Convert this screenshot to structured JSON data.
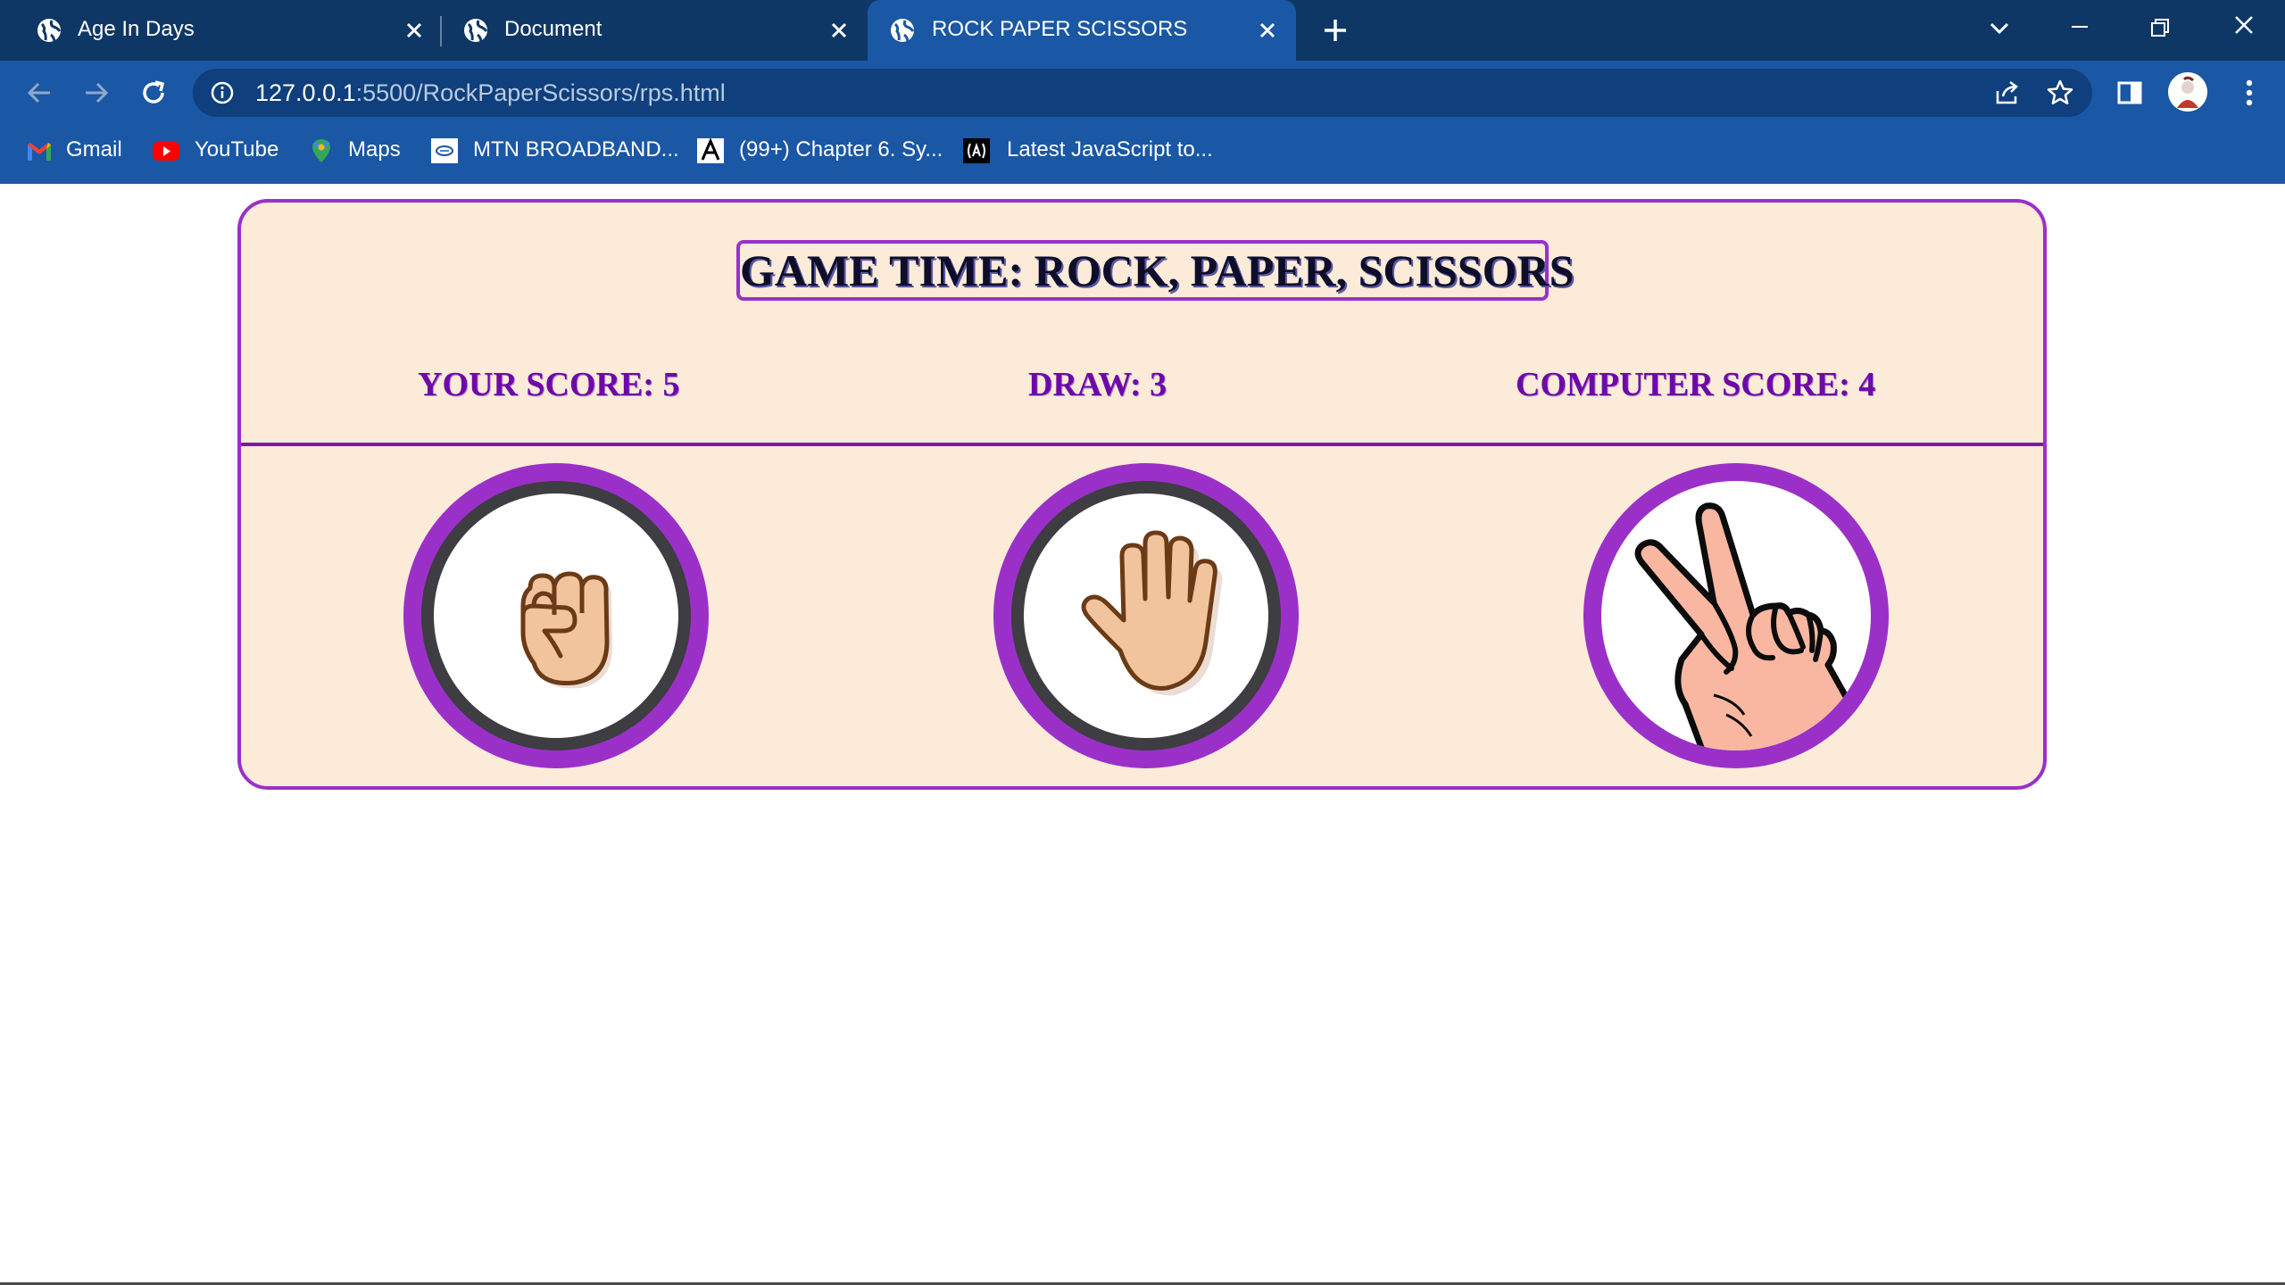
{
  "browser": {
    "tabs": [
      {
        "title": "Age In Days",
        "active": false
      },
      {
        "title": "Document",
        "active": false
      },
      {
        "title": "ROCK PAPER SCISSORS",
        "active": true
      }
    ],
    "url_host": "127.0.0.1",
    "url_path": ":5500/RockPaperScissors/rps.html",
    "bookmarks": [
      {
        "label": "Gmail",
        "icon": "gmail-icon"
      },
      {
        "label": "YouTube",
        "icon": "youtube-icon"
      },
      {
        "label": "Maps",
        "icon": "maps-icon"
      },
      {
        "label": "MTN BROADBAND...",
        "icon": "mtn-icon"
      },
      {
        "label": "(99+) Chapter 6. Sy...",
        "icon": "academia-icon"
      },
      {
        "label": "Latest JavaScript to...",
        "icon": "javascript-icon"
      }
    ],
    "colors": {
      "tabbar": "#0f3766",
      "toolbar": "#1a57a5"
    }
  },
  "game": {
    "title": "GAME TIME: ROCK, PAPER, SCISSORS",
    "your_score_label": "YOUR SCORE: 5",
    "draw_label": "DRAW: 3",
    "computer_score_label": "COMPUTER SCORE: 4",
    "choices": [
      {
        "name": "rock",
        "icon": "raised-fist-icon"
      },
      {
        "name": "paper",
        "icon": "raised-hand-icon"
      },
      {
        "name": "scissors",
        "icon": "victory-hand-icon"
      }
    ],
    "colors": {
      "accent": "#9b30c9",
      "score_text": "#6d0aa7",
      "panel_bg": "#fbebd8",
      "title_text": "#0e0e2b"
    }
  }
}
